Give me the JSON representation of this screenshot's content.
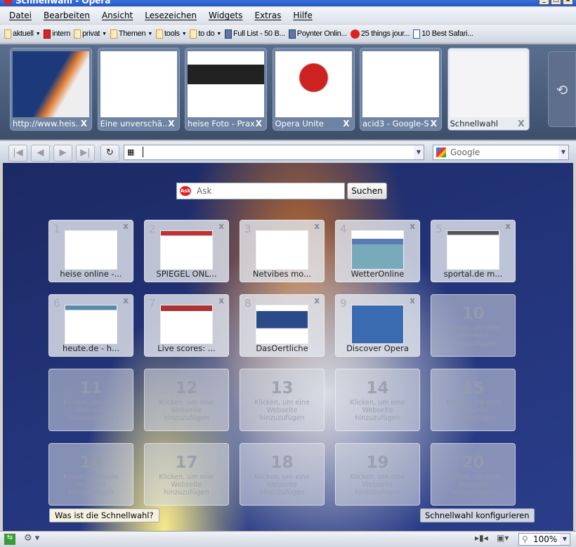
{
  "window": {
    "title": "Schnellwahl - Opera"
  },
  "menu": [
    "Datei",
    "Bearbeiten",
    "Ansicht",
    "Lesezeichen",
    "Widgets",
    "Extras",
    "Hilfe"
  ],
  "bookmarks": [
    {
      "label": "aktuell",
      "icon": "folder",
      "dropdown": true
    },
    {
      "label": "intern",
      "icon": "red-bookmark",
      "dropdown": false
    },
    {
      "label": "privat",
      "icon": "folder",
      "dropdown": true
    },
    {
      "label": "Themen",
      "icon": "folder",
      "dropdown": true
    },
    {
      "label": "tools",
      "icon": "folder",
      "dropdown": true
    },
    {
      "label": "to do",
      "icon": "folder",
      "dropdown": true
    },
    {
      "label": "Full List - 50 B...",
      "icon": "star",
      "dropdown": false
    },
    {
      "label": "Poynter Onlin...",
      "icon": "star",
      "dropdown": false
    },
    {
      "label": "25 things jour...",
      "icon": "e",
      "dropdown": false
    },
    {
      "label": "10 Best Safari...",
      "icon": "check",
      "dropdown": false
    }
  ],
  "tabs": [
    {
      "label": "http://www.heis...",
      "close": "X"
    },
    {
      "label": "Eine unverschä...",
      "close": "X"
    },
    {
      "label": "heise Foto - Praxis",
      "close": "X"
    },
    {
      "label": "Opera Unite",
      "close": "X"
    },
    {
      "label": "acid3 - Google-S...",
      "close": "X"
    },
    {
      "label": "Schnellwahl",
      "close": "X",
      "active": true
    }
  ],
  "nav": {
    "address": "",
    "search_engine": "Google"
  },
  "speeddial": {
    "search_placeholder": "Ask",
    "search_button": "Suchen",
    "tiles": [
      {
        "n": "1",
        "title": "heise online -..."
      },
      {
        "n": "2",
        "title": "SPIEGEL ONL..."
      },
      {
        "n": "3",
        "title": "Netvibes mo..."
      },
      {
        "n": "4",
        "title": "WetterOnline"
      },
      {
        "n": "5",
        "title": "sportal.de m..."
      },
      {
        "n": "6",
        "title": "heute.de - h..."
      },
      {
        "n": "7",
        "title": "Live scores: ..."
      },
      {
        "n": "8",
        "title": "DasOertliche"
      },
      {
        "n": "9",
        "title": "Discover Opera"
      }
    ],
    "empty_tiles": [
      "10",
      "11",
      "12",
      "13",
      "14",
      "15",
      "16",
      "17",
      "18",
      "19",
      "20"
    ],
    "empty_text": "Klicken, um eine Webseite hinzuzufügen",
    "help_button": "Was ist die Schnellwahl?",
    "config_button": "Schnellwahl konfigurieren"
  },
  "status": {
    "zoom": "100%"
  }
}
